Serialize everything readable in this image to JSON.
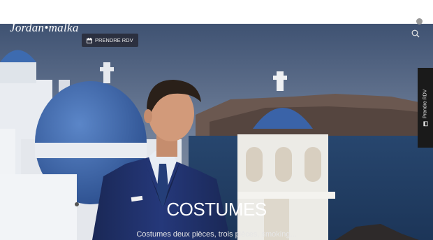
{
  "header": {
    "logo_text": "Jordan•malka",
    "appointment_button_label": "PRENDRE RDV"
  },
  "side_tab": {
    "label": "Prendre RDV"
  },
  "hero": {
    "title": "COSTUMES",
    "subtitle": "Costumes deux pièces, trois pièces, smoking..."
  },
  "icons": {
    "search": "search-icon",
    "calendar": "calendar-icon",
    "scroll": "scroll-indicator"
  },
  "colors": {
    "sky": "#5d6f8c",
    "dome_blue": "#3a63a8",
    "suit_navy": "#1f2f63",
    "side_tab_bg": "#1a1a1a"
  }
}
